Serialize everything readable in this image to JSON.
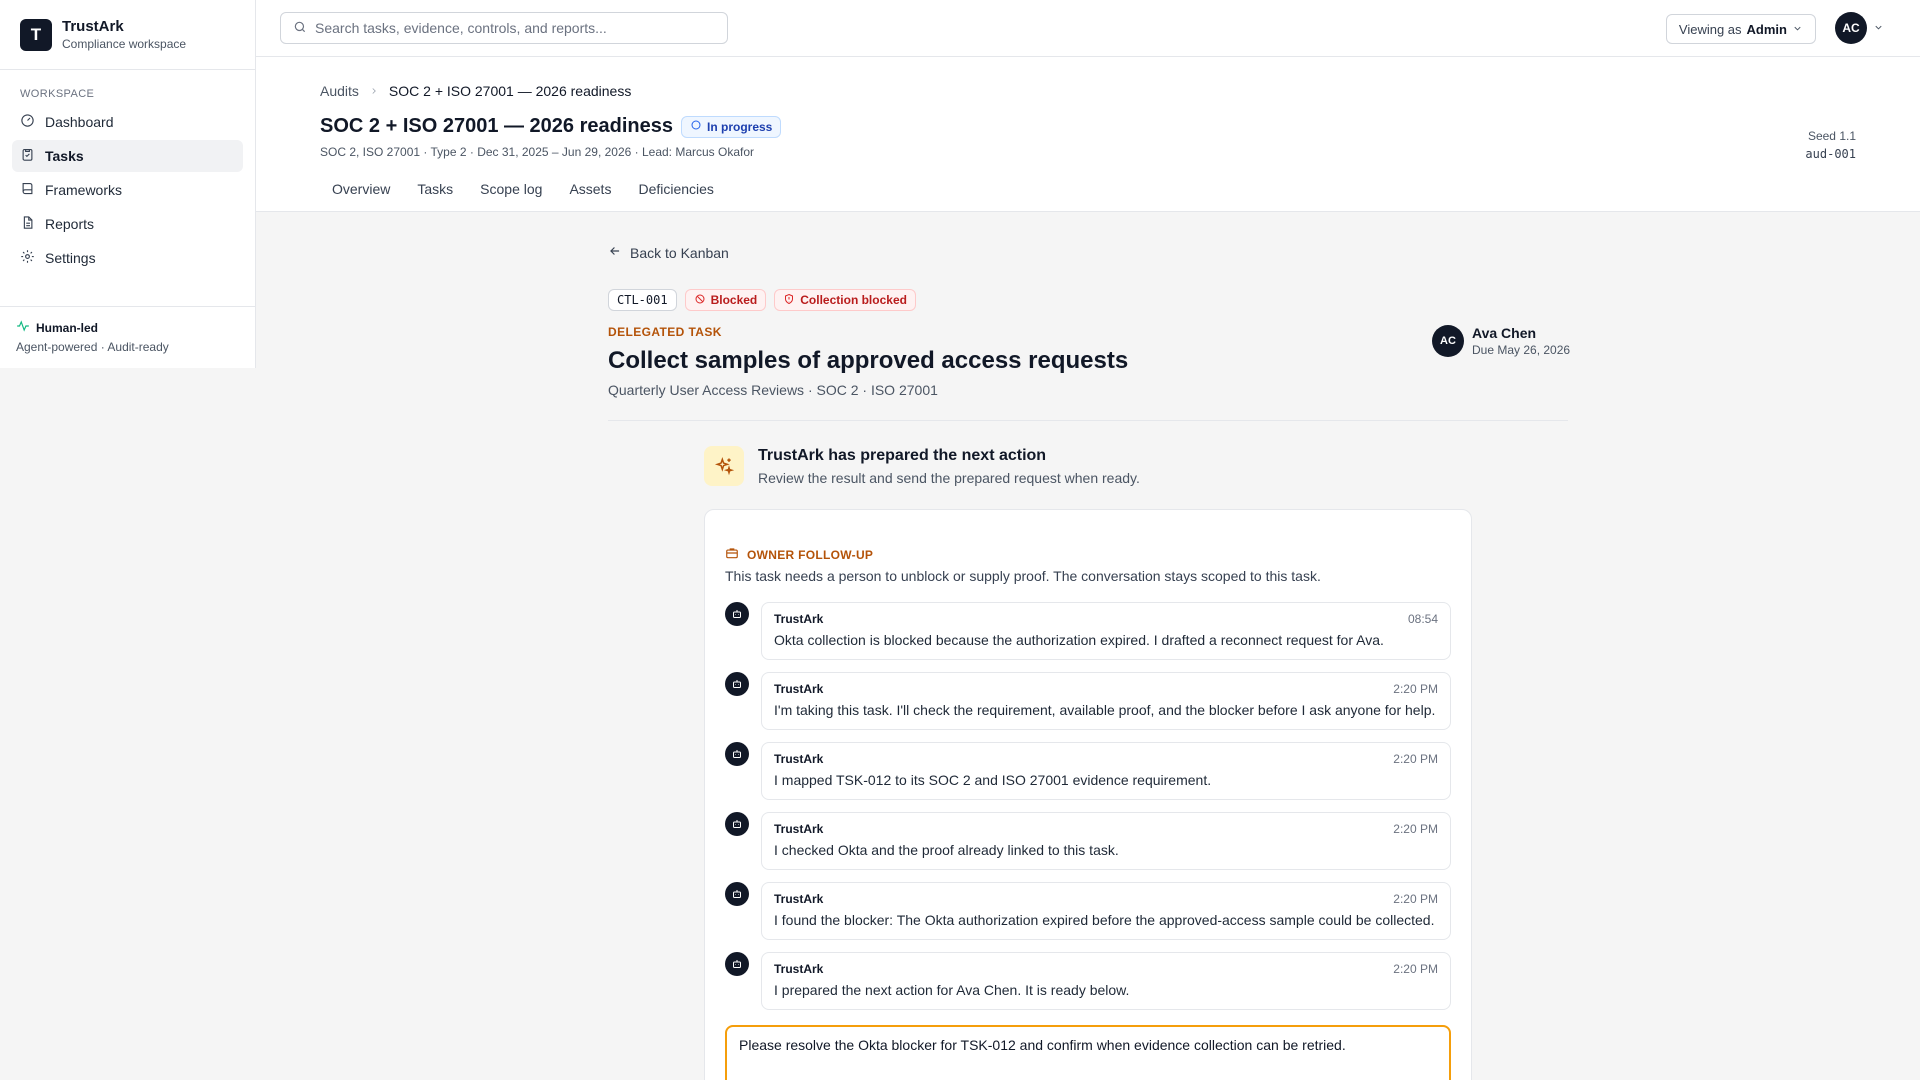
{
  "brand": {
    "logo_letter": "T",
    "name": "TrustArk",
    "subtitle": "Compliance workspace"
  },
  "sidebar": {
    "heading": "WORKSPACE",
    "items": [
      {
        "label": "Dashboard",
        "icon": "dashboard-icon"
      },
      {
        "label": "Tasks",
        "icon": "clipboard-icon",
        "active": true
      },
      {
        "label": "Frameworks",
        "icon": "book-icon"
      },
      {
        "label": "Reports",
        "icon": "document-icon"
      },
      {
        "label": "Settings",
        "icon": "gear-icon"
      }
    ],
    "footer": {
      "title": "Human-led",
      "subtitle": "Agent-powered · Audit-ready"
    }
  },
  "topbar": {
    "search_placeholder": "Search tasks, evidence, controls, and reports...",
    "viewing_prefix": "Viewing as",
    "viewing_role": "Admin",
    "avatar_initials": "AC"
  },
  "page": {
    "breadcrumb": [
      "Audits",
      "SOC 2 + ISO 27001 — 2026 readiness"
    ],
    "title": "SOC 2 + ISO 27001 — 2026 readiness",
    "status": "In progress",
    "meta": "SOC 2, ISO 27001 · Type 2 · Dec 31, 2025 – Jun 29, 2026 · Lead: Marcus Okafor",
    "seed_label": "Seed 1.1",
    "audit_id": "aud-001",
    "tabs": [
      "Overview",
      "Tasks",
      "Scope log",
      "Assets",
      "Deficiencies"
    ]
  },
  "task": {
    "back_label": "Back to Kanban",
    "id": "CTL-001",
    "tags": [
      "Blocked",
      "Collection blocked"
    ],
    "kicker": "DELEGATED TASK",
    "title": "Collect samples of approved access requests",
    "subtitle": "Quarterly User Access Reviews · SOC 2 · ISO 27001",
    "assignee": {
      "initials": "AC",
      "name": "Ava Chen",
      "due": "Due May 26, 2026"
    }
  },
  "prepared": {
    "title": "TrustArk has prepared the next action",
    "subtitle": "Review the result and send the prepared request when ready."
  },
  "followup": {
    "label": "OWNER FOLLOW-UP",
    "description": "This task needs a person to unblock or supply proof. The conversation stays scoped to this task."
  },
  "messages": [
    {
      "author": "TrustArk",
      "time": "08:54",
      "text": "Okta collection is blocked because the authorization expired. I drafted a reconnect request for Ava."
    },
    {
      "author": "TrustArk",
      "time": "2:20 PM",
      "text": "I'm taking this task. I'll check the requirement, available proof, and the blocker before I ask anyone for help."
    },
    {
      "author": "TrustArk",
      "time": "2:20 PM",
      "text": "I mapped TSK-012 to its SOC 2 and ISO 27001 evidence requirement."
    },
    {
      "author": "TrustArk",
      "time": "2:20 PM",
      "text": "I checked Okta and the proof already linked to this task."
    },
    {
      "author": "TrustArk",
      "time": "2:20 PM",
      "text": "I found the blocker: The Okta authorization expired before the approved-access sample could be collected."
    },
    {
      "author": "TrustArk",
      "time": "2:20 PM",
      "text": "I prepared the next action for Ava Chen. It is ready below."
    }
  ],
  "reply": {
    "value": "Please resolve the Okta blocker for TSK-012 and confirm when evidence collection can be retried."
  },
  "colors": {
    "accent": "#b45309",
    "blocked": "#dc2626",
    "status": "#2563eb",
    "focus": "#f59e0b"
  }
}
